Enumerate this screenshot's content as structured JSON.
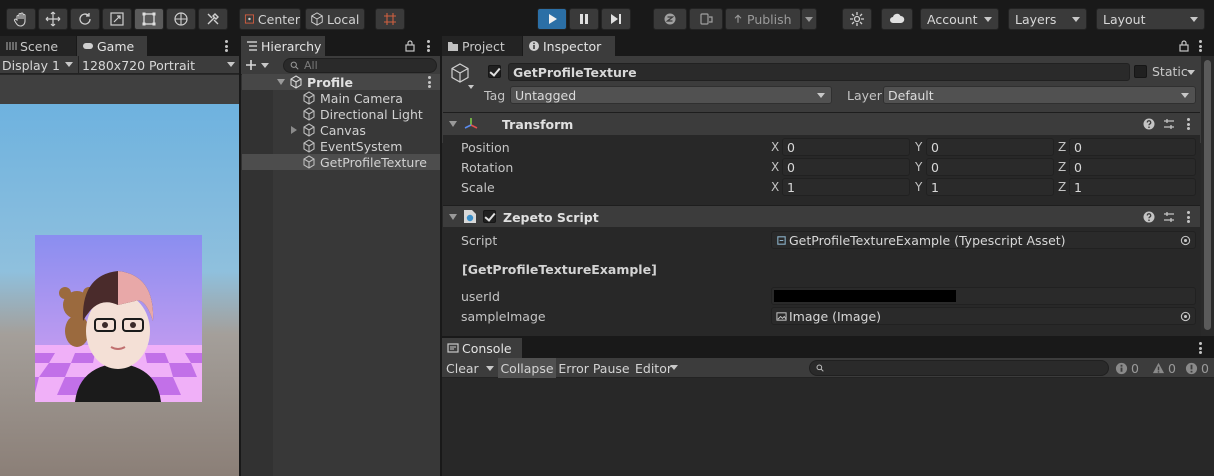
{
  "toolbar": {
    "tools": [
      "hand-tool",
      "move-tool",
      "rotate-tool",
      "scale-tool",
      "rect-tool",
      "transform-tool",
      "custom-tool"
    ],
    "pivot_label": "Center",
    "space_label": "Local",
    "publish_label": "Publish",
    "account_label": "Account",
    "layers_label": "Layers",
    "layout_label": "Layout"
  },
  "game_panel": {
    "tabs": [
      "Scene",
      "Game"
    ],
    "active_tab": "Game",
    "display_label": "Display 1",
    "resolution_label": "1280x720 Portrait"
  },
  "hierarchy": {
    "tab_label": "Hierarchy",
    "search_placeholder": "All",
    "scene_name": "Profile",
    "items": [
      {
        "label": "Main Camera",
        "expandable": false
      },
      {
        "label": "Directional Light",
        "expandable": false
      },
      {
        "label": "Canvas",
        "expandable": true
      },
      {
        "label": "EventSystem",
        "expandable": false
      },
      {
        "label": "GetProfileTexture",
        "expandable": false,
        "selected": true
      }
    ]
  },
  "inspector": {
    "tabs": [
      "Project",
      "Inspector"
    ],
    "active_tab": "Inspector",
    "object_name": "GetProfileTexture",
    "active": true,
    "static_label": "Static",
    "tag_label": "Tag",
    "tag_value": "Untagged",
    "layer_label": "Layer",
    "layer_value": "Default",
    "transform": {
      "title": "Transform",
      "rows": [
        {
          "label": "Position",
          "x": "0",
          "y": "0",
          "z": "0"
        },
        {
          "label": "Rotation",
          "x": "0",
          "y": "0",
          "z": "0"
        },
        {
          "label": "Scale",
          "x": "1",
          "y": "1",
          "z": "1"
        }
      ],
      "axis_x": "X",
      "axis_y": "Y",
      "axis_z": "Z"
    },
    "script": {
      "title": "Zepeto Script",
      "enabled": true,
      "script_label": "Script",
      "script_value": "GetProfileTextureExample (Typescript Asset)",
      "class_header": "[GetProfileTextureExample]",
      "userid_label": "userId",
      "userid_value": "",
      "sample_label": "sampleImage",
      "sample_value": "Image (Image)"
    }
  },
  "console": {
    "tab_label": "Console",
    "clear_label": "Clear",
    "collapse_label": "Collapse",
    "error_pause_label": "Error Pause",
    "editor_label": "Editor",
    "search_placeholder": "",
    "info_count": "0",
    "warning_count": "0",
    "error_count": "0"
  },
  "colors": {
    "accent_selected": "#2c5d87",
    "play_active": "#2b6fa6",
    "panel_bg": "#282828",
    "header_bg": "#3c3c3c"
  }
}
